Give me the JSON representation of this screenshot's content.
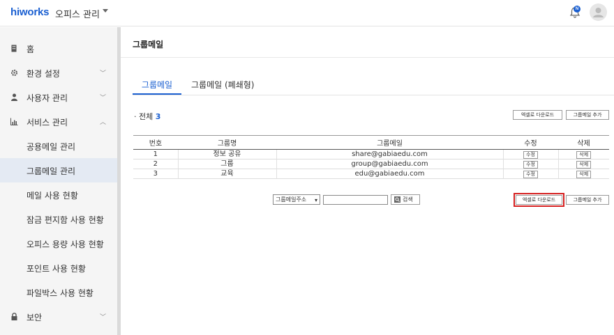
{
  "header": {
    "logo": "hiworks",
    "office_menu": "오피스 관리",
    "notification_badge": "N"
  },
  "sidebar": {
    "items": [
      {
        "label": "홈",
        "icon": "building-icon"
      },
      {
        "label": "환경 설정",
        "icon": "gear-icon",
        "chevron": "﹀"
      },
      {
        "label": "사용자 관리",
        "icon": "person-icon",
        "chevron": "﹀"
      },
      {
        "label": "서비스 관리",
        "icon": "chart-icon",
        "chevron": "︿"
      },
      {
        "label": "공용메일 관리"
      },
      {
        "label": "그룹메일 관리"
      },
      {
        "label": "메일 사용 현황"
      },
      {
        "label": "잠금 편지함 사용 현황"
      },
      {
        "label": "오피스 용량 사용 현황"
      },
      {
        "label": "포인트 사용 현황"
      },
      {
        "label": "파일박스 사용 현황"
      },
      {
        "label": "보안",
        "icon": "lock-icon",
        "chevron": "﹀"
      }
    ]
  },
  "main": {
    "title": "그룹메일",
    "tabs": [
      {
        "label": "그룹메일"
      },
      {
        "label": "그룹메일 (폐쇄형)"
      }
    ],
    "total_label": "· 전체",
    "total_count": "3",
    "excel_download": "엑셀로 다운로드",
    "add_groupmail": "그룹메일 추가",
    "table": {
      "headers": [
        "번호",
        "그룹명",
        "그룹메일",
        "수정",
        "삭제"
      ],
      "rows": [
        {
          "no": "1",
          "name": "정보 공유",
          "email": "share@gabiaedu.com",
          "edit": "수정",
          "delete": "삭제"
        },
        {
          "no": "2",
          "name": "그룹",
          "email": "group@gabiaedu.com",
          "edit": "수정",
          "delete": "삭제"
        },
        {
          "no": "3",
          "name": "교육",
          "email": "edu@gabiaedu.com",
          "edit": "수정",
          "delete": "삭제"
        }
      ]
    },
    "search": {
      "select_value": "그룹메일주소",
      "input_value": "",
      "button_label": "검색"
    }
  },
  "colors": {
    "accent": "#1a5fd1",
    "highlight": "#d62020"
  }
}
